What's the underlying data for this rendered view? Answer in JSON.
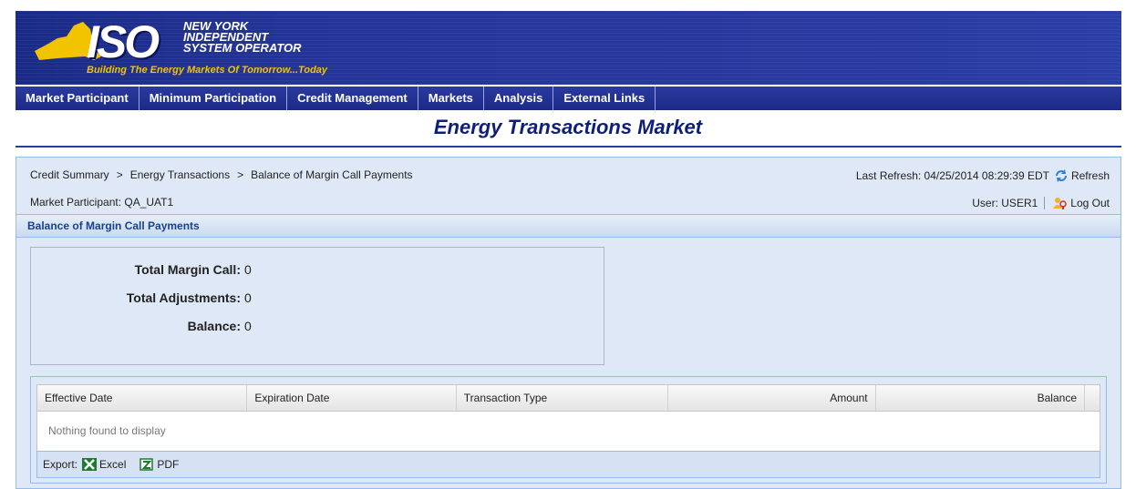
{
  "header": {
    "logo_text": "ISO",
    "org_name_lines": [
      "NEW YORK",
      "INDEPENDENT",
      "SYSTEM OPERATOR"
    ],
    "tagline": "Building The Energy Markets Of Tomorrow...Today"
  },
  "menu": [
    {
      "label": "Market Participant"
    },
    {
      "label": "Minimum Participation"
    },
    {
      "label": "Credit Management"
    },
    {
      "label": "Markets"
    },
    {
      "label": "Analysis"
    },
    {
      "label": "External Links"
    }
  ],
  "page_title": "Energy Transactions Market",
  "breadcrumb": {
    "items": [
      "Credit Summary",
      "Energy Transactions",
      "Balance of Margin Call Payments"
    ],
    "separator": ">"
  },
  "market_participant": "Market Participant: QA_UAT1",
  "refresh": {
    "last_refresh": "Last Refresh: 04/25/2014 08:29:39 EDT",
    "refresh_label": "Refresh"
  },
  "user": {
    "label": "User: USER1",
    "logout_label": "Log Out"
  },
  "section_title": "Balance of Margin Call Payments",
  "summary": [
    {
      "label": "Total Margin Call:",
      "value": "0"
    },
    {
      "label": "Total Adjustments:",
      "value": "0"
    },
    {
      "label": "Balance:",
      "value": "0"
    }
  ],
  "table": {
    "columns": [
      "Effective Date",
      "Expiration Date",
      "Transaction Type",
      "Amount",
      "Balance"
    ],
    "empty_message": "Nothing found to display"
  },
  "export": {
    "label": "Export:",
    "excel_label": "Excel",
    "pdf_label": "PDF"
  },
  "colors": {
    "nav_blue": "#1c2a86",
    "title_blue": "#0e1f7a",
    "panel_bg": "#dfe8f6",
    "tagline_yellow": "#f2c400"
  },
  "icons": {
    "refresh": "refresh-icon",
    "logout": "key-people-icon",
    "excel": "excel-icon",
    "pdf": "pdf-icon"
  }
}
